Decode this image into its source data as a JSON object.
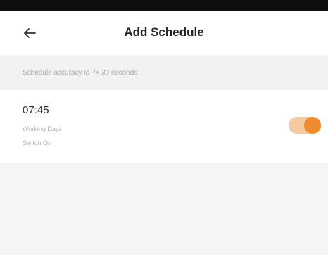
{
  "header": {
    "title": "Add Schedule",
    "back_icon": "arrow-left-icon"
  },
  "notice": {
    "text": "Schedule accuracy is -/+ 30 seconds"
  },
  "schedule": {
    "time": "07:45",
    "repeat": "Working Days",
    "action": "Switch On",
    "enabled": true
  },
  "colors": {
    "accent": "#f08a2c",
    "toggle_track": "#f6caa0",
    "status_strip": "#0e0e0e"
  }
}
